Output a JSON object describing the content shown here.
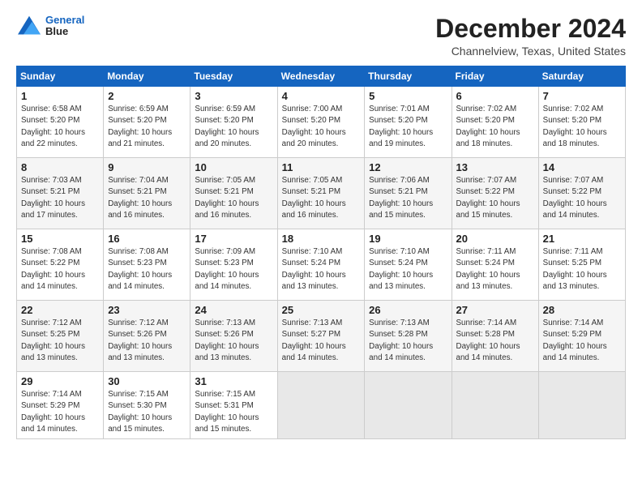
{
  "header": {
    "logo_line1": "General",
    "logo_line2": "Blue",
    "month": "December 2024",
    "location": "Channelview, Texas, United States"
  },
  "weekdays": [
    "Sunday",
    "Monday",
    "Tuesday",
    "Wednesday",
    "Thursday",
    "Friday",
    "Saturday"
  ],
  "weeks": [
    [
      {
        "day": "1",
        "info": "Sunrise: 6:58 AM\nSunset: 5:20 PM\nDaylight: 10 hours\nand 22 minutes."
      },
      {
        "day": "2",
        "info": "Sunrise: 6:59 AM\nSunset: 5:20 PM\nDaylight: 10 hours\nand 21 minutes."
      },
      {
        "day": "3",
        "info": "Sunrise: 6:59 AM\nSunset: 5:20 PM\nDaylight: 10 hours\nand 20 minutes."
      },
      {
        "day": "4",
        "info": "Sunrise: 7:00 AM\nSunset: 5:20 PM\nDaylight: 10 hours\nand 20 minutes."
      },
      {
        "day": "5",
        "info": "Sunrise: 7:01 AM\nSunset: 5:20 PM\nDaylight: 10 hours\nand 19 minutes."
      },
      {
        "day": "6",
        "info": "Sunrise: 7:02 AM\nSunset: 5:20 PM\nDaylight: 10 hours\nand 18 minutes."
      },
      {
        "day": "7",
        "info": "Sunrise: 7:02 AM\nSunset: 5:20 PM\nDaylight: 10 hours\nand 18 minutes."
      }
    ],
    [
      {
        "day": "8",
        "info": "Sunrise: 7:03 AM\nSunset: 5:21 PM\nDaylight: 10 hours\nand 17 minutes."
      },
      {
        "day": "9",
        "info": "Sunrise: 7:04 AM\nSunset: 5:21 PM\nDaylight: 10 hours\nand 16 minutes."
      },
      {
        "day": "10",
        "info": "Sunrise: 7:05 AM\nSunset: 5:21 PM\nDaylight: 10 hours\nand 16 minutes."
      },
      {
        "day": "11",
        "info": "Sunrise: 7:05 AM\nSunset: 5:21 PM\nDaylight: 10 hours\nand 16 minutes."
      },
      {
        "day": "12",
        "info": "Sunrise: 7:06 AM\nSunset: 5:21 PM\nDaylight: 10 hours\nand 15 minutes."
      },
      {
        "day": "13",
        "info": "Sunrise: 7:07 AM\nSunset: 5:22 PM\nDaylight: 10 hours\nand 15 minutes."
      },
      {
        "day": "14",
        "info": "Sunrise: 7:07 AM\nSunset: 5:22 PM\nDaylight: 10 hours\nand 14 minutes."
      }
    ],
    [
      {
        "day": "15",
        "info": "Sunrise: 7:08 AM\nSunset: 5:22 PM\nDaylight: 10 hours\nand 14 minutes."
      },
      {
        "day": "16",
        "info": "Sunrise: 7:08 AM\nSunset: 5:23 PM\nDaylight: 10 hours\nand 14 minutes."
      },
      {
        "day": "17",
        "info": "Sunrise: 7:09 AM\nSunset: 5:23 PM\nDaylight: 10 hours\nand 14 minutes."
      },
      {
        "day": "18",
        "info": "Sunrise: 7:10 AM\nSunset: 5:24 PM\nDaylight: 10 hours\nand 13 minutes."
      },
      {
        "day": "19",
        "info": "Sunrise: 7:10 AM\nSunset: 5:24 PM\nDaylight: 10 hours\nand 13 minutes."
      },
      {
        "day": "20",
        "info": "Sunrise: 7:11 AM\nSunset: 5:24 PM\nDaylight: 10 hours\nand 13 minutes."
      },
      {
        "day": "21",
        "info": "Sunrise: 7:11 AM\nSunset: 5:25 PM\nDaylight: 10 hours\nand 13 minutes."
      }
    ],
    [
      {
        "day": "22",
        "info": "Sunrise: 7:12 AM\nSunset: 5:25 PM\nDaylight: 10 hours\nand 13 minutes."
      },
      {
        "day": "23",
        "info": "Sunrise: 7:12 AM\nSunset: 5:26 PM\nDaylight: 10 hours\nand 13 minutes."
      },
      {
        "day": "24",
        "info": "Sunrise: 7:13 AM\nSunset: 5:26 PM\nDaylight: 10 hours\nand 13 minutes."
      },
      {
        "day": "25",
        "info": "Sunrise: 7:13 AM\nSunset: 5:27 PM\nDaylight: 10 hours\nand 14 minutes."
      },
      {
        "day": "26",
        "info": "Sunrise: 7:13 AM\nSunset: 5:28 PM\nDaylight: 10 hours\nand 14 minutes."
      },
      {
        "day": "27",
        "info": "Sunrise: 7:14 AM\nSunset: 5:28 PM\nDaylight: 10 hours\nand 14 minutes."
      },
      {
        "day": "28",
        "info": "Sunrise: 7:14 AM\nSunset: 5:29 PM\nDaylight: 10 hours\nand 14 minutes."
      }
    ],
    [
      {
        "day": "29",
        "info": "Sunrise: 7:14 AM\nSunset: 5:29 PM\nDaylight: 10 hours\nand 14 minutes."
      },
      {
        "day": "30",
        "info": "Sunrise: 7:15 AM\nSunset: 5:30 PM\nDaylight: 10 hours\nand 15 minutes."
      },
      {
        "day": "31",
        "info": "Sunrise: 7:15 AM\nSunset: 5:31 PM\nDaylight: 10 hours\nand 15 minutes."
      },
      {
        "day": "",
        "info": ""
      },
      {
        "day": "",
        "info": ""
      },
      {
        "day": "",
        "info": ""
      },
      {
        "day": "",
        "info": ""
      }
    ]
  ]
}
